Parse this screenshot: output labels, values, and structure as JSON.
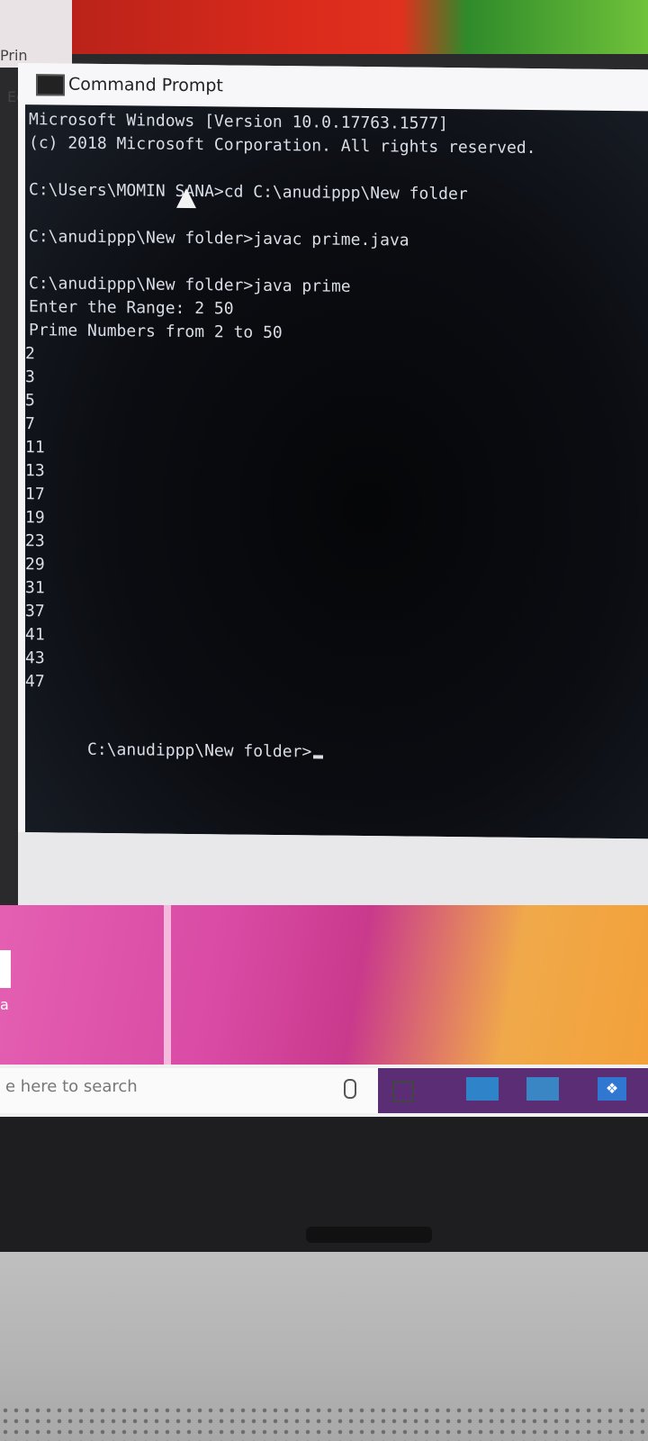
{
  "window": {
    "title": "Command Prompt"
  },
  "desktop": {
    "label_top": "Prin",
    "label_ed": "Ed",
    "label_a": "a"
  },
  "console": {
    "lines": [
      "Microsoft Windows [Version 10.0.17763.1577]",
      "(c) 2018 Microsoft Corporation. All rights reserved.",
      "C:\\Users\\MOMIN SANA>cd C:\\anudippp\\New folder",
      "C:\\anudippp\\New folder>javac prime.java",
      "C:\\anudippp\\New folder>java prime",
      "Enter the Range: 2 50",
      "Prime Numbers from 2 to 50"
    ],
    "primes": [
      "2",
      "3",
      "5",
      "7",
      "11",
      "13",
      "17",
      "19",
      "23",
      "29",
      "31",
      "37",
      "41",
      "43",
      "47"
    ],
    "prompt": "C:\\anudippp\\New folder>"
  },
  "taskbar": {
    "search_placeholder": "e here to search",
    "dropbox_glyph": "❖"
  }
}
